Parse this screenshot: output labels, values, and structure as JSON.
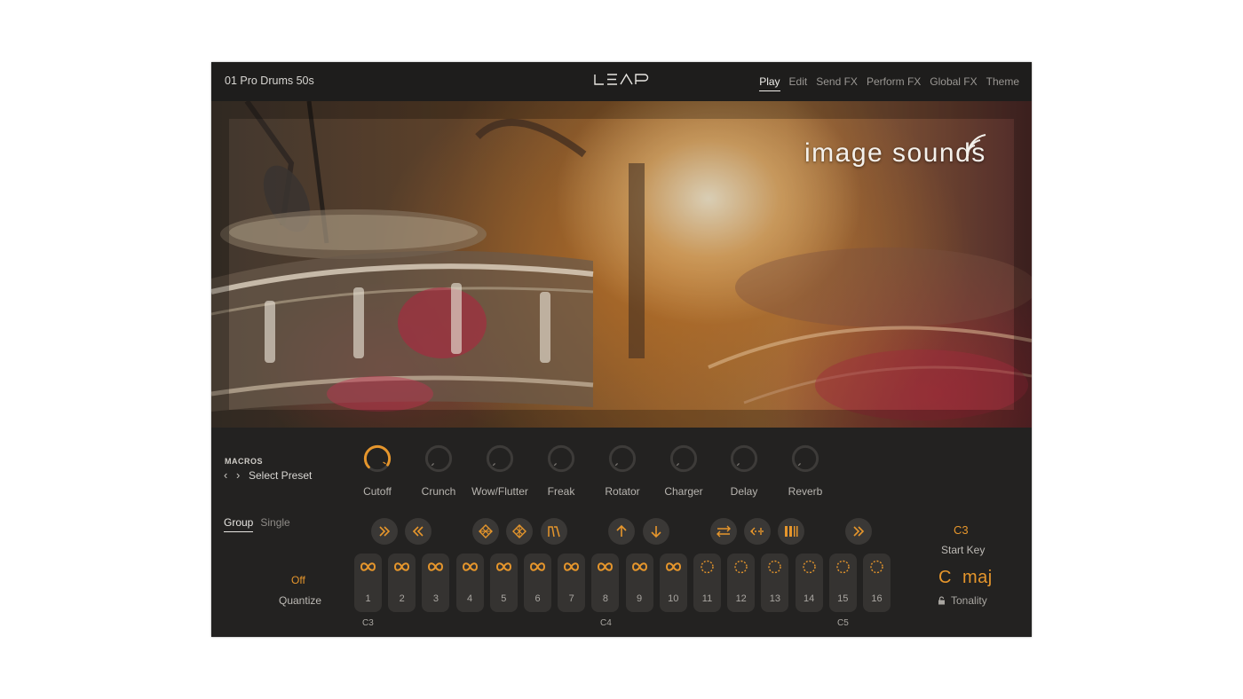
{
  "header": {
    "preset_name": "01 Pro Drums 50s",
    "logo_text": "LEAP",
    "tabs": [
      {
        "label": "Play",
        "active": true
      },
      {
        "label": "Edit",
        "active": false
      },
      {
        "label": "Send FX",
        "active": false
      },
      {
        "label": "Perform FX",
        "active": false
      },
      {
        "label": "Global FX",
        "active": false
      },
      {
        "label": "Theme",
        "active": false
      }
    ]
  },
  "hero": {
    "brand": "image sounds"
  },
  "macros": {
    "section_label": "MACROS",
    "select_preset": "Select Preset",
    "knobs": [
      {
        "label": "Cutoff",
        "value": 0.95,
        "active": true
      },
      {
        "label": "Crunch",
        "value": 0.0,
        "active": false
      },
      {
        "label": "Wow/Flutter",
        "value": 0.0,
        "active": false
      },
      {
        "label": "Freak",
        "value": 0.0,
        "active": false
      },
      {
        "label": "Rotator",
        "value": 0.0,
        "active": false
      },
      {
        "label": "Charger",
        "value": 0.0,
        "active": false
      },
      {
        "label": "Delay",
        "value": 0.0,
        "active": false
      },
      {
        "label": "Reverb",
        "value": 0.0,
        "active": false
      }
    ]
  },
  "mode_tabs": [
    {
      "label": "Group",
      "active": true
    },
    {
      "label": "Single",
      "active": false
    }
  ],
  "quantize": {
    "value": "Off",
    "label": "Quantize"
  },
  "function_buttons": [
    {
      "icon": "fast-forward-icon"
    },
    {
      "icon": "rewind-icon"
    },
    {
      "icon": "grid-slice-icon"
    },
    {
      "icon": "grid-slice-alt-icon"
    },
    {
      "icon": "envelope-icon"
    },
    {
      "icon": "arrow-up-icon"
    },
    {
      "icon": "arrow-down-icon"
    },
    {
      "icon": "swap-icon"
    },
    {
      "icon": "dotted-arrow-icon"
    },
    {
      "icon": "bars-icon"
    },
    {
      "icon": "fast-forward-icon"
    }
  ],
  "keys": [
    {
      "number": "1",
      "mode": "loop"
    },
    {
      "number": "2",
      "mode": "loop"
    },
    {
      "number": "3",
      "mode": "loop"
    },
    {
      "number": "4",
      "mode": "loop"
    },
    {
      "number": "5",
      "mode": "loop"
    },
    {
      "number": "6",
      "mode": "loop"
    },
    {
      "number": "7",
      "mode": "loop"
    },
    {
      "number": "8",
      "mode": "loop"
    },
    {
      "number": "9",
      "mode": "loop"
    },
    {
      "number": "10",
      "mode": "loop"
    },
    {
      "number": "11",
      "mode": "oneshot"
    },
    {
      "number": "12",
      "mode": "oneshot"
    },
    {
      "number": "13",
      "mode": "oneshot"
    },
    {
      "number": "14",
      "mode": "oneshot"
    },
    {
      "number": "15",
      "mode": "oneshot"
    },
    {
      "number": "16",
      "mode": "oneshot"
    }
  ],
  "octave_labels": [
    "C3",
    "C4",
    "C5"
  ],
  "start_key": {
    "value": "C3",
    "label": "Start Key"
  },
  "tonality": {
    "value": "C maj",
    "label": "Tonality"
  },
  "colors": {
    "accent": "#e6962c",
    "panel": "#232221",
    "pad": "#353331"
  }
}
